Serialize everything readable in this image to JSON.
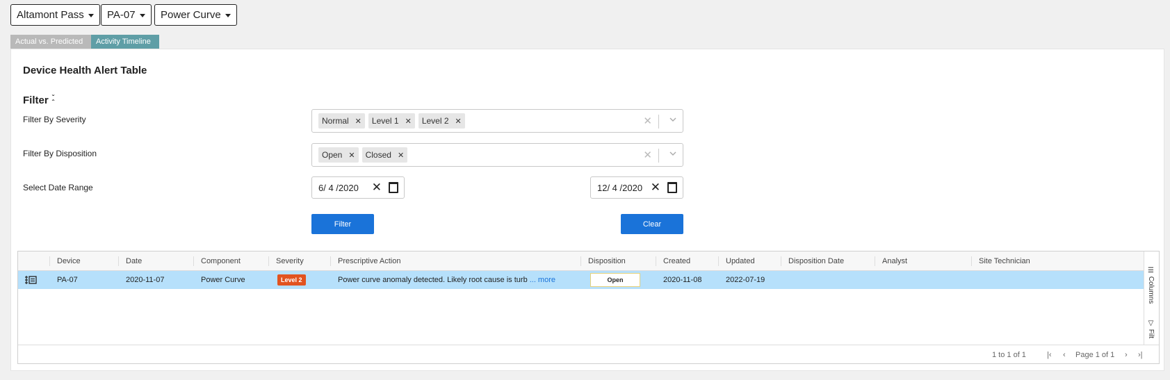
{
  "selectors": {
    "site": "Altamont Pass",
    "turbine": "PA-07",
    "view": "Power Curve"
  },
  "tabs": [
    {
      "label": "Actual vs. Predicted"
    },
    {
      "label": "Activity Timeline"
    }
  ],
  "panel": {
    "title": "Device Health Alert Table",
    "filter_heading": "Filter"
  },
  "filters": {
    "severity_label": "Filter By Severity",
    "severity_chips": [
      "Normal",
      "Level 1",
      "Level 2"
    ],
    "disposition_label": "Filter By Disposition",
    "disposition_chips": [
      "Open",
      "Closed"
    ],
    "date_range_label": "Select Date Range",
    "start_date": "6/ 4 /2020",
    "end_date": "12/ 4 /2020",
    "filter_button": "Filter",
    "clear_button": "Clear"
  },
  "table": {
    "columns": [
      "Device",
      "Date",
      "Component",
      "Severity",
      "Prescriptive Action",
      "Disposition",
      "Created",
      "Updated",
      "Disposition Date",
      "Analyst",
      "Site Technician"
    ],
    "rows": [
      {
        "device": "PA-07",
        "date": "2020-11-07",
        "component": "Power Curve",
        "severity": "Level 2",
        "action": "Power curve anomaly detected. Likely root cause is turb",
        "more": "... more",
        "disposition": "Open",
        "created": "2020-11-08",
        "updated": "2022-07-19",
        "disposition_date": "",
        "analyst": "",
        "site_technician": ""
      }
    ],
    "side_tabs": [
      "Columns",
      "Filt"
    ],
    "row_count": "1 to 1 of 1",
    "page_info": "Page 1 of 1"
  },
  "colors": {
    "tab_inactive": "#b9b9b9",
    "tab_active": "#5f9ea6",
    "primary_button": "#1a73d9",
    "selected_row": "#b6e0fb",
    "severity_level2": "#e2531f"
  }
}
